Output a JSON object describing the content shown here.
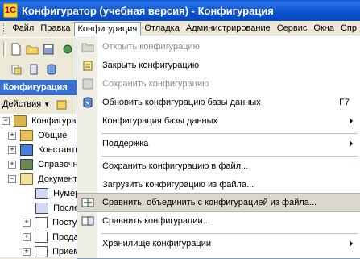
{
  "window": {
    "title": "Конфигуратор (учебная версия) - Конфигурация"
  },
  "menubar": {
    "items": [
      {
        "label": "Файл",
        "active": false
      },
      {
        "label": "Правка",
        "active": false
      },
      {
        "label": "Конфигурация",
        "active": true
      },
      {
        "label": "Отладка",
        "active": false
      },
      {
        "label": "Администрирование",
        "active": false
      },
      {
        "label": "Сервис",
        "active": false
      },
      {
        "label": "Окна",
        "active": false
      },
      {
        "label": "Спр",
        "active": false
      }
    ]
  },
  "left_panel": {
    "header": "Конфигурация",
    "actions_label": "Действия",
    "tree": [
      {
        "label": "Конфигурация",
        "icon": "config-icon"
      },
      {
        "label": "Общие",
        "icon": "common-icon"
      },
      {
        "label": "Константы",
        "icon": "constants-icon"
      },
      {
        "label": "Справочни",
        "icon": "catalogs-icon"
      },
      {
        "label": "Документы",
        "icon": "documents-icon"
      },
      {
        "label": "Нумер",
        "icon": "numerator-icon"
      },
      {
        "label": "Последо",
        "icon": "sequence-icon"
      },
      {
        "label": "Посту",
        "icon": "document-icon"
      },
      {
        "label": "Прода",
        "icon": "document-icon"
      },
      {
        "label": "Прием",
        "icon": "document-icon"
      }
    ]
  },
  "dropdown": {
    "items": [
      {
        "label": "Открыть конфигурацию",
        "disabled": true,
        "icon": "open-icon"
      },
      {
        "label": "Закрыть конфигурацию",
        "disabled": false,
        "icon": "close-config-icon"
      },
      {
        "label": "Сохранить конфигурацию",
        "disabled": true,
        "icon": "save-icon"
      },
      {
        "label": "Обновить конфигурацию базы данных",
        "disabled": false,
        "icon": "update-db-icon",
        "shortcut": "F7"
      },
      {
        "label": "Конфигурация базы данных",
        "disabled": false,
        "submenu": true
      },
      {
        "label": "Поддержка",
        "disabled": false,
        "submenu": true
      },
      {
        "label": "Сохранить конфигурацию в файл...",
        "disabled": false
      },
      {
        "label": "Загрузить конфигурацию из файла...",
        "disabled": false
      },
      {
        "label": "Сравнить, объединить с конфигурацией из файла...",
        "disabled": false,
        "highlight": true,
        "icon": "compare-merge-icon"
      },
      {
        "label": "Сравнить конфигурации...",
        "disabled": false,
        "icon": "compare-icon"
      },
      {
        "label": "Хранилище конфигурации",
        "disabled": false,
        "submenu": true
      }
    ]
  },
  "colors": {
    "titlebar": "#0a52cc",
    "highlight": "#dad8ce",
    "panel_header": "#3a6fd0"
  }
}
